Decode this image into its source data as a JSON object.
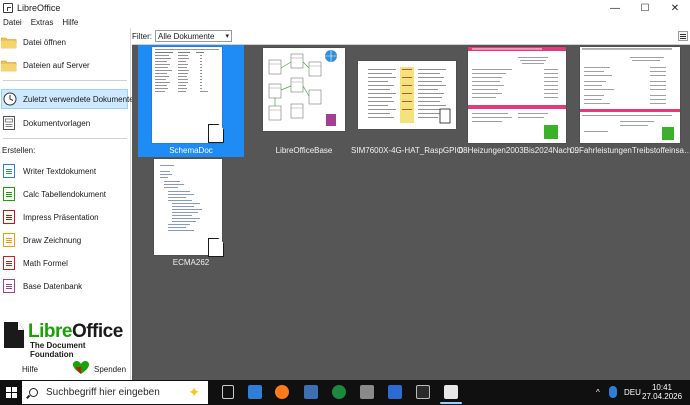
{
  "window": {
    "title": "LibreOffice",
    "minimize": "—",
    "maximize": "☐",
    "close": "✕"
  },
  "menu": [
    "Datei",
    "Extras",
    "Hilfe"
  ],
  "sidebar": {
    "top_items": [
      {
        "label": "Datei öffnen",
        "icon": "folder-open-icon"
      },
      {
        "label": "Dateien auf Server",
        "icon": "folder-remote-icon"
      },
      {
        "label": "Zuletzt verwendete Dokumente",
        "icon": "clock-icon",
        "active": true
      },
      {
        "label": "Dokumentvorlagen",
        "icon": "templates-icon"
      }
    ],
    "create_label": "Erstellen:",
    "create_items": [
      {
        "label": "Writer Textdokument",
        "icon": "writer-icon",
        "color": "#2a7fd4"
      },
      {
        "label": "Calc Tabellendokument",
        "icon": "calc-icon",
        "color": "#18a303"
      },
      {
        "label": "Impress Präsentation",
        "icon": "impress-icon",
        "color": "#d0120d"
      },
      {
        "label": "Draw Zeichnung",
        "icon": "draw-icon",
        "color": "#e9a100"
      },
      {
        "label": "Math Formel",
        "icon": "math-icon",
        "color": "#c9211e"
      },
      {
        "label": "Base Datenbank",
        "icon": "base-icon",
        "color": "#a33e95"
      }
    ],
    "logo_libre": "Libre",
    "logo_office": "Office",
    "logo_sub": "The Document Foundation",
    "help_label": "Hilfe",
    "donate_label": "Spenden"
  },
  "filter": {
    "label": "Filter:",
    "value": "Alle Dokumente"
  },
  "documents": [
    {
      "name": "SchemaDoc",
      "selected": true
    },
    {
      "name": "LibreOfficeBase",
      "selected": false
    },
    {
      "name": "SIM7600X-4G-HAT_RaspGPIO",
      "selected": false
    },
    {
      "name": "08Heizungen2003Bis2024Nach…",
      "selected": false
    },
    {
      "name": "09FahrleistungenTreibstoffeinsa…",
      "selected": false
    },
    {
      "name": "ECMA262",
      "selected": false
    }
  ],
  "taskbar": {
    "search_placeholder": "Suchbegriff hier eingeben",
    "language": "DEU",
    "time": "10:41",
    "date": "27.04.2026",
    "tray_chevron": "^"
  }
}
